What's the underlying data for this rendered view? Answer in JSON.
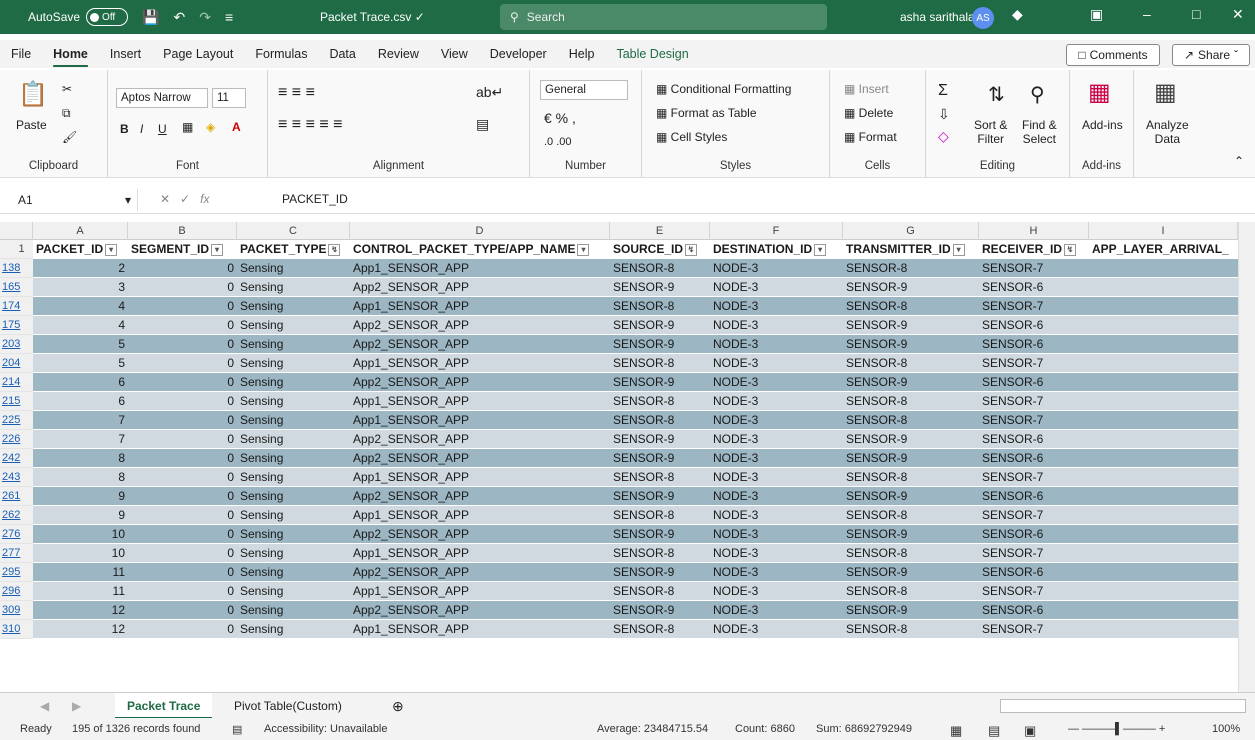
{
  "titlebar": {
    "autosave_label": "AutoSave",
    "autosave_state": "Off",
    "filename": "Packet Trace.csv ✓",
    "search_placeholder": "Search",
    "user_name": "asha sarithala",
    "user_initials": "AS"
  },
  "menu": {
    "tabs": [
      "File",
      "Home",
      "Insert",
      "Page Layout",
      "Formulas",
      "Data",
      "Review",
      "View",
      "Developer",
      "Help",
      "Table Design"
    ],
    "comments_label": "Comments",
    "share_label": "Share"
  },
  "ribbon": {
    "clipboard": {
      "label": "Clipboard",
      "paste": "Paste"
    },
    "font": {
      "label": "Font",
      "font_name": "Aptos Narrow",
      "font_size": "11"
    },
    "alignment": {
      "label": "Alignment"
    },
    "number": {
      "label": "Number",
      "format": "General"
    },
    "styles": {
      "label": "Styles",
      "conditional": "Conditional Formatting",
      "format_table": "Format as Table",
      "cell_styles": "Cell Styles"
    },
    "cells": {
      "label": "Cells",
      "insert": "Insert",
      "delete": "Delete",
      "format": "Format"
    },
    "editing": {
      "label": "Editing",
      "sort": "Sort &",
      "sort2": "Filter",
      "find": "Find &",
      "find2": "Select"
    },
    "addins": {
      "label": "Add-ins",
      "addins_btn": "Add-ins",
      "analyze": "Analyze",
      "analyze2": "Data"
    }
  },
  "formula_bar": {
    "cell_ref": "A1",
    "content": "PACKET_ID"
  },
  "grid": {
    "column_letters": [
      "A",
      "B",
      "C",
      "D",
      "E",
      "F",
      "G",
      "H",
      "I"
    ],
    "headers": [
      "PACKET_ID",
      "SEGMENT_ID",
      "PACKET_TYPE",
      "CONTROL_PACKET_TYPE/APP_NAME",
      "SOURCE_ID",
      "DESTINATION_ID",
      "TRANSMITTER_ID",
      "RECEIVER_ID",
      "APP_LAYER_ARRIVAL_"
    ],
    "header_row_number": "1",
    "rows": [
      {
        "n": "138",
        "cells": [
          "2",
          "0",
          "Sensing",
          "App1_SENSOR_APP",
          "SENSOR-8",
          "NODE-3",
          "SENSOR-8",
          "SENSOR-7"
        ]
      },
      {
        "n": "165",
        "cells": [
          "3",
          "0",
          "Sensing",
          "App2_SENSOR_APP",
          "SENSOR-9",
          "NODE-3",
          "SENSOR-9",
          "SENSOR-6"
        ]
      },
      {
        "n": "174",
        "cells": [
          "4",
          "0",
          "Sensing",
          "App1_SENSOR_APP",
          "SENSOR-8",
          "NODE-3",
          "SENSOR-8",
          "SENSOR-7"
        ]
      },
      {
        "n": "175",
        "cells": [
          "4",
          "0",
          "Sensing",
          "App2_SENSOR_APP",
          "SENSOR-9",
          "NODE-3",
          "SENSOR-9",
          "SENSOR-6"
        ]
      },
      {
        "n": "203",
        "cells": [
          "5",
          "0",
          "Sensing",
          "App2_SENSOR_APP",
          "SENSOR-9",
          "NODE-3",
          "SENSOR-9",
          "SENSOR-6"
        ]
      },
      {
        "n": "204",
        "cells": [
          "5",
          "0",
          "Sensing",
          "App1_SENSOR_APP",
          "SENSOR-8",
          "NODE-3",
          "SENSOR-8",
          "SENSOR-7"
        ]
      },
      {
        "n": "214",
        "cells": [
          "6",
          "0",
          "Sensing",
          "App2_SENSOR_APP",
          "SENSOR-9",
          "NODE-3",
          "SENSOR-9",
          "SENSOR-6"
        ]
      },
      {
        "n": "215",
        "cells": [
          "6",
          "0",
          "Sensing",
          "App1_SENSOR_APP",
          "SENSOR-8",
          "NODE-3",
          "SENSOR-8",
          "SENSOR-7"
        ]
      },
      {
        "n": "225",
        "cells": [
          "7",
          "0",
          "Sensing",
          "App1_SENSOR_APP",
          "SENSOR-8",
          "NODE-3",
          "SENSOR-8",
          "SENSOR-7"
        ]
      },
      {
        "n": "226",
        "cells": [
          "7",
          "0",
          "Sensing",
          "App2_SENSOR_APP",
          "SENSOR-9",
          "NODE-3",
          "SENSOR-9",
          "SENSOR-6"
        ]
      },
      {
        "n": "242",
        "cells": [
          "8",
          "0",
          "Sensing",
          "App2_SENSOR_APP",
          "SENSOR-9",
          "NODE-3",
          "SENSOR-9",
          "SENSOR-6"
        ]
      },
      {
        "n": "243",
        "cells": [
          "8",
          "0",
          "Sensing",
          "App1_SENSOR_APP",
          "SENSOR-8",
          "NODE-3",
          "SENSOR-8",
          "SENSOR-7"
        ]
      },
      {
        "n": "261",
        "cells": [
          "9",
          "0",
          "Sensing",
          "App2_SENSOR_APP",
          "SENSOR-9",
          "NODE-3",
          "SENSOR-9",
          "SENSOR-6"
        ]
      },
      {
        "n": "262",
        "cells": [
          "9",
          "0",
          "Sensing",
          "App1_SENSOR_APP",
          "SENSOR-8",
          "NODE-3",
          "SENSOR-8",
          "SENSOR-7"
        ]
      },
      {
        "n": "276",
        "cells": [
          "10",
          "0",
          "Sensing",
          "App2_SENSOR_APP",
          "SENSOR-9",
          "NODE-3",
          "SENSOR-9",
          "SENSOR-6"
        ]
      },
      {
        "n": "277",
        "cells": [
          "10",
          "0",
          "Sensing",
          "App1_SENSOR_APP",
          "SENSOR-8",
          "NODE-3",
          "SENSOR-8",
          "SENSOR-7"
        ]
      },
      {
        "n": "295",
        "cells": [
          "11",
          "0",
          "Sensing",
          "App2_SENSOR_APP",
          "SENSOR-9",
          "NODE-3",
          "SENSOR-9",
          "SENSOR-6"
        ]
      },
      {
        "n": "296",
        "cells": [
          "11",
          "0",
          "Sensing",
          "App1_SENSOR_APP",
          "SENSOR-8",
          "NODE-3",
          "SENSOR-8",
          "SENSOR-7"
        ]
      },
      {
        "n": "309",
        "cells": [
          "12",
          "0",
          "Sensing",
          "App2_SENSOR_APP",
          "SENSOR-9",
          "NODE-3",
          "SENSOR-9",
          "SENSOR-6"
        ]
      },
      {
        "n": "310",
        "cells": [
          "12",
          "0",
          "Sensing",
          "App1_SENSOR_APP",
          "SENSOR-8",
          "NODE-3",
          "SENSOR-8",
          "SENSOR-7"
        ]
      }
    ]
  },
  "sheets": {
    "tabs": [
      "Packet Trace",
      "Pivot Table(Custom)"
    ],
    "active": "Packet Trace"
  },
  "status": {
    "ready": "Ready",
    "records": "195 of 1326 records found",
    "accessibility": "Accessibility: Unavailable",
    "average": "Average: 23484715.54",
    "count": "Count: 6860",
    "sum": "Sum: 68692792949",
    "zoom": "100%"
  },
  "colors": {
    "titlebar": "#1e6b45",
    "band_dark": "#9cb6c3",
    "band_light": "#cfd9df",
    "link": "#1a5fb4"
  }
}
